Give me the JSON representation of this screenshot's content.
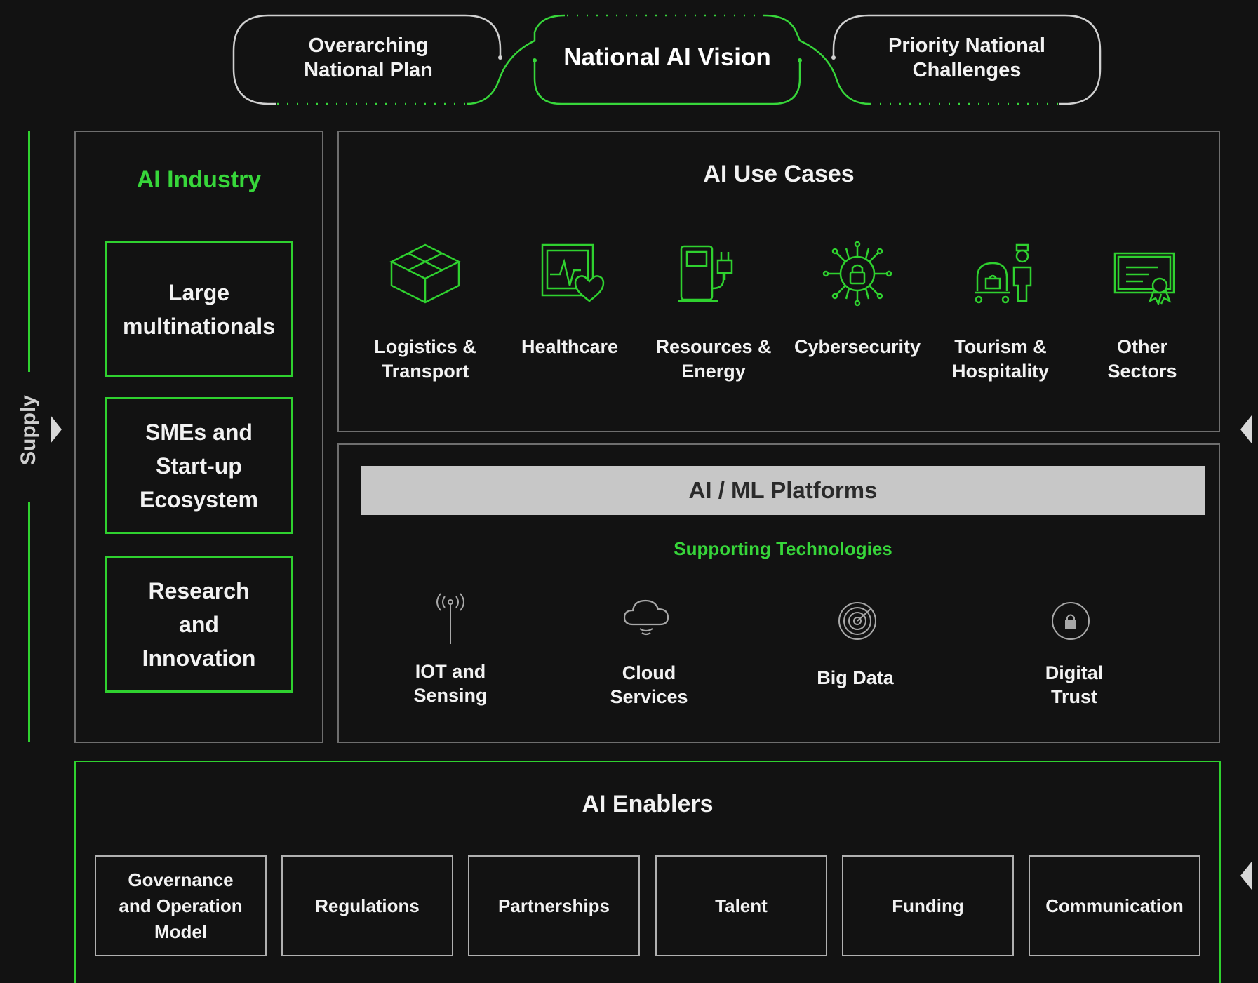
{
  "header": {
    "left_pill": "Overarching\nNational Plan",
    "center_pill": "National AI Vision",
    "right_pill": "Priority National\nChallenges"
  },
  "supply": {
    "label": "Supply"
  },
  "industry": {
    "title": "AI Industry",
    "items": [
      "Large\nmultinationals",
      "SMEs and\nStart-up\nEcosystem",
      "Research\nand\nInnovation"
    ]
  },
  "use_cases": {
    "title": "AI Use Cases",
    "items": [
      {
        "label": "Logistics &\nTransport",
        "icon": "box-icon"
      },
      {
        "label": "Healthcare",
        "icon": "heart-monitor-icon"
      },
      {
        "label": "Resources &\nEnergy",
        "icon": "fuel-pump-icon"
      },
      {
        "label": "Cybersecurity",
        "icon": "circuit-lock-icon"
      },
      {
        "label": "Tourism &\nHospitality",
        "icon": "bellhop-luggage-icon"
      },
      {
        "label": "Other\nSectors",
        "icon": "certificate-icon"
      }
    ]
  },
  "platforms": {
    "title": "AI / ML Platforms",
    "supporting_title": "Supporting Technologies",
    "items": [
      {
        "label": "IOT and\nSensing",
        "icon": "antenna-icon"
      },
      {
        "label": "Cloud\nServices",
        "icon": "cloud-icon"
      },
      {
        "label": "Big Data",
        "icon": "radar-icon"
      },
      {
        "label": "Digital\nTrust",
        "icon": "lock-icon"
      }
    ]
  },
  "enablers": {
    "title": "AI Enablers",
    "items": [
      "Governance\nand Operation\nModel",
      "Regulations",
      "Partnerships",
      "Talent",
      "Funding",
      "Communication"
    ]
  },
  "colors": {
    "accent": "#2fd12f",
    "background": "#121212",
    "panel_border": "#6e6e6e",
    "bar": "#c7c7c7"
  }
}
